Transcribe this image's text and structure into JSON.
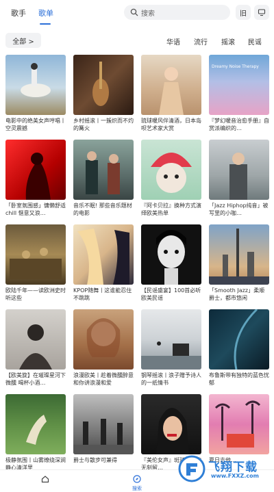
{
  "header": {
    "tabs": [
      {
        "label": "歌手"
      },
      {
        "label": "歌单"
      }
    ],
    "search_placeholder": "搜索",
    "history_button": "旧"
  },
  "filters": {
    "all_label": "全部 >",
    "genres": [
      "华语",
      "流行",
      "摇滚",
      "民谣"
    ]
  },
  "playlists": [
    {
      "title": "电影中的绝美女声哼唱丨空灵震撼"
    },
    {
      "title": "乡村摇滚丨一簇炽而不灼的篝火"
    },
    {
      "title": "琉球暖风伴清酒，日本岛呗艺术家大赏"
    },
    {
      "title": "『梦幻暖音治愈手册』自赏派编织的…",
      "thumb_text": "Dreamy Noise Therapy"
    },
    {
      "title": "「卧室氛围感」慵懒舒适chill 惬意又浪…"
    },
    {
      "title": "音乐不眠! 那些音乐题材的电影"
    },
    {
      "title": "『阿卡贝拉』换种方式演绎欧美热单"
    },
    {
      "title": "「Jazz Hiphop纯音」被写里的小咖…"
    },
    {
      "title": "欧陆千年——读欧洲史时听这些"
    },
    {
      "title": "KPOP随舞丨这谁能忍住不跳跳"
    },
    {
      "title": "【民谣盛宴】100首必听欧美民谣"
    },
    {
      "title": "「Smooth Jazz」柔顺爵士，都市悠闲"
    },
    {
      "title": "【欧美旋】在璀璨星河下微醺 喝杯小酒…"
    },
    {
      "title": "浪漫欧美丨趁着微醺醉意和你讲浪漫和爱"
    },
    {
      "title": "钢琴摇滚丨浪子赠予诗人的一纸情书"
    },
    {
      "title": "布鲁斯带有独特的蓝色忧郁"
    },
    {
      "title": "极静氛围丨山雾缭绕深涧静心清洋里"
    },
    {
      "title": "爵士与散步可兼得"
    },
    {
      "title": "『美伦女声』斑驳时光的无刻留…"
    },
    {
      "title": "夏日吉他…"
    }
  ],
  "bottom_nav": {
    "explore_label": "搜索"
  },
  "watermark": {
    "text": "飞翔下载",
    "url": "www.FXXZ.com"
  },
  "colors": {
    "accent": "#2b6fd8"
  }
}
